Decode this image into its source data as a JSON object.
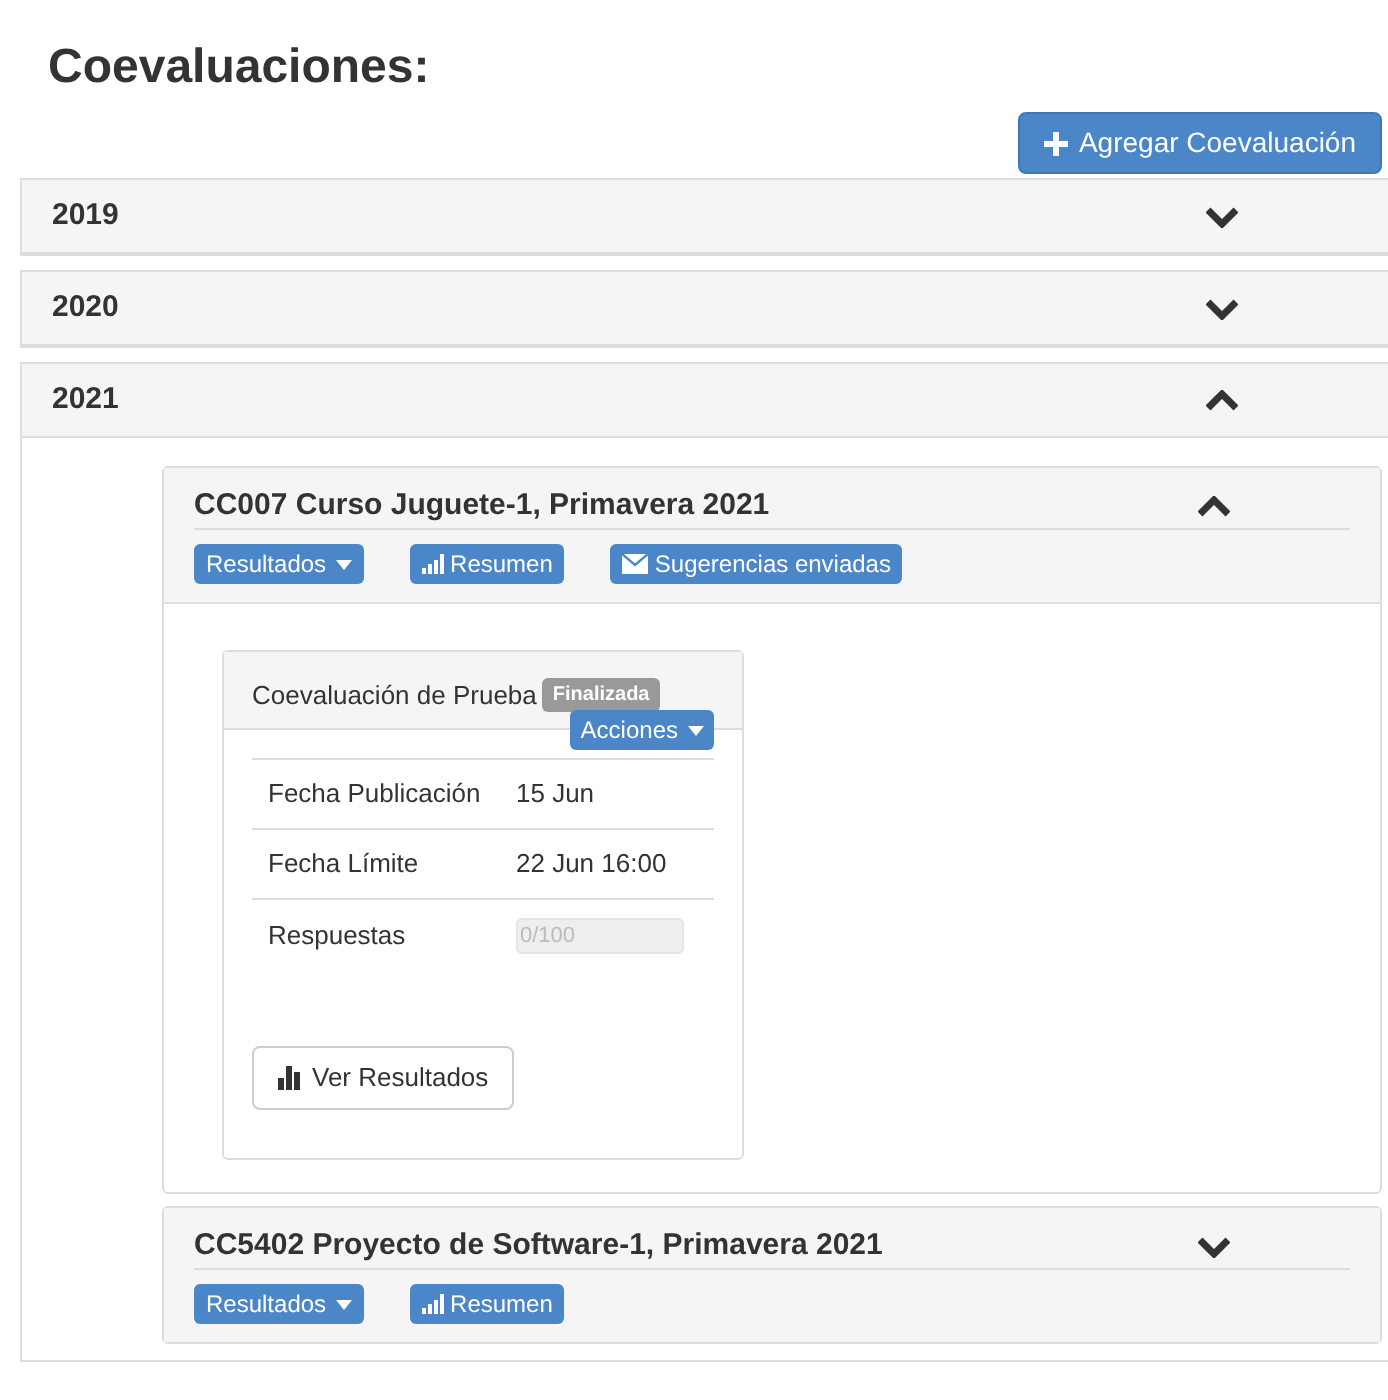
{
  "title": "Coevaluaciones:",
  "add_button": {
    "label": "Agregar Coevaluación"
  },
  "years": [
    {
      "label": "2019",
      "expanded": false
    },
    {
      "label": "2020",
      "expanded": false
    },
    {
      "label": "2021",
      "expanded": true,
      "courses": [
        {
          "title": "CC007 Curso Juguete-1, Primavera 2021",
          "expanded": true,
          "buttons": [
            {
              "kind": "dropdown",
              "label": "Resultados"
            },
            {
              "kind": "chart",
              "label": "Resumen"
            },
            {
              "kind": "mail",
              "label": "Sugerencias enviadas"
            }
          ],
          "evaluations": [
            {
              "title": "Coevaluación de Prueba",
              "badge": "Finalizada",
              "actions": "Acciones",
              "rows": [
                {
                  "kind": "text",
                  "label": "Fecha Publicación",
                  "value": "15 Jun"
                },
                {
                  "kind": "text",
                  "label": "Fecha Límite",
                  "value": "22 Jun 16:00"
                },
                {
                  "kind": "field",
                  "label": "Respuestas",
                  "value": "0/100",
                  "disabled": true
                }
              ],
              "results_button": "Ver Resultados"
            }
          ]
        },
        {
          "title": "CC5402 Proyecto de Software-1, Primavera 2021",
          "expanded": false,
          "buttons": [
            {
              "kind": "dropdown",
              "label": "Resultados"
            },
            {
              "kind": "chart",
              "label": "Resumen"
            }
          ]
        }
      ]
    }
  ]
}
